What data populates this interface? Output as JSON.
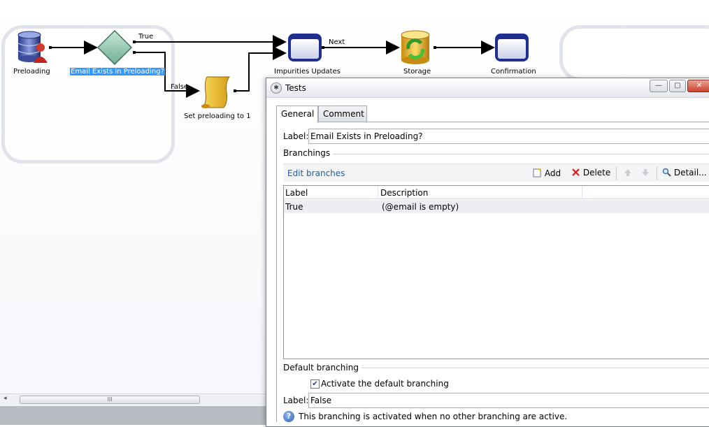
{
  "workflow": {
    "nodes": {
      "preloading": "Preloading",
      "email_exists": "Email Exists in Preloading?",
      "set_preloading": "Set preloading to 1",
      "impurities_updates": "Impurities Updates",
      "storage": "Storage",
      "confirmation": "Confirmation"
    },
    "transitions": {
      "true": "True",
      "false": "False",
      "next": "Next"
    }
  },
  "canvas_scrollbar": {
    "left_arrow": "◂",
    "thumb_grip": "III"
  },
  "dialog": {
    "title": "Tests",
    "window_buttons": {
      "minimize": "—",
      "maximize": "▢",
      "close": "✕"
    },
    "tabs": [
      {
        "label": "General",
        "active": true
      },
      {
        "label": "Comment",
        "active": false
      }
    ],
    "label_field": {
      "label": "Label:",
      "value": "Email Exists in Preloading?"
    },
    "branchings": {
      "title": "Branchings",
      "edit_link": "Edit branches",
      "toolbar": {
        "add": "Add",
        "delete": "Delete",
        "detail": "Detail..."
      },
      "columns": [
        "Label",
        "Description"
      ],
      "rows": [
        {
          "label": "True",
          "description": "(@email is empty)"
        }
      ]
    },
    "default_branching": {
      "title": "Default branching",
      "checkbox_label": "Activate the default branching",
      "checked": true,
      "label_field": {
        "label": "Label:",
        "value": "False"
      },
      "help_text": "This branching is activated when no other branching are active."
    }
  },
  "colors": {
    "selection": "#3399ff",
    "link": "#1f5fa8",
    "close_button": "#c9442c"
  }
}
